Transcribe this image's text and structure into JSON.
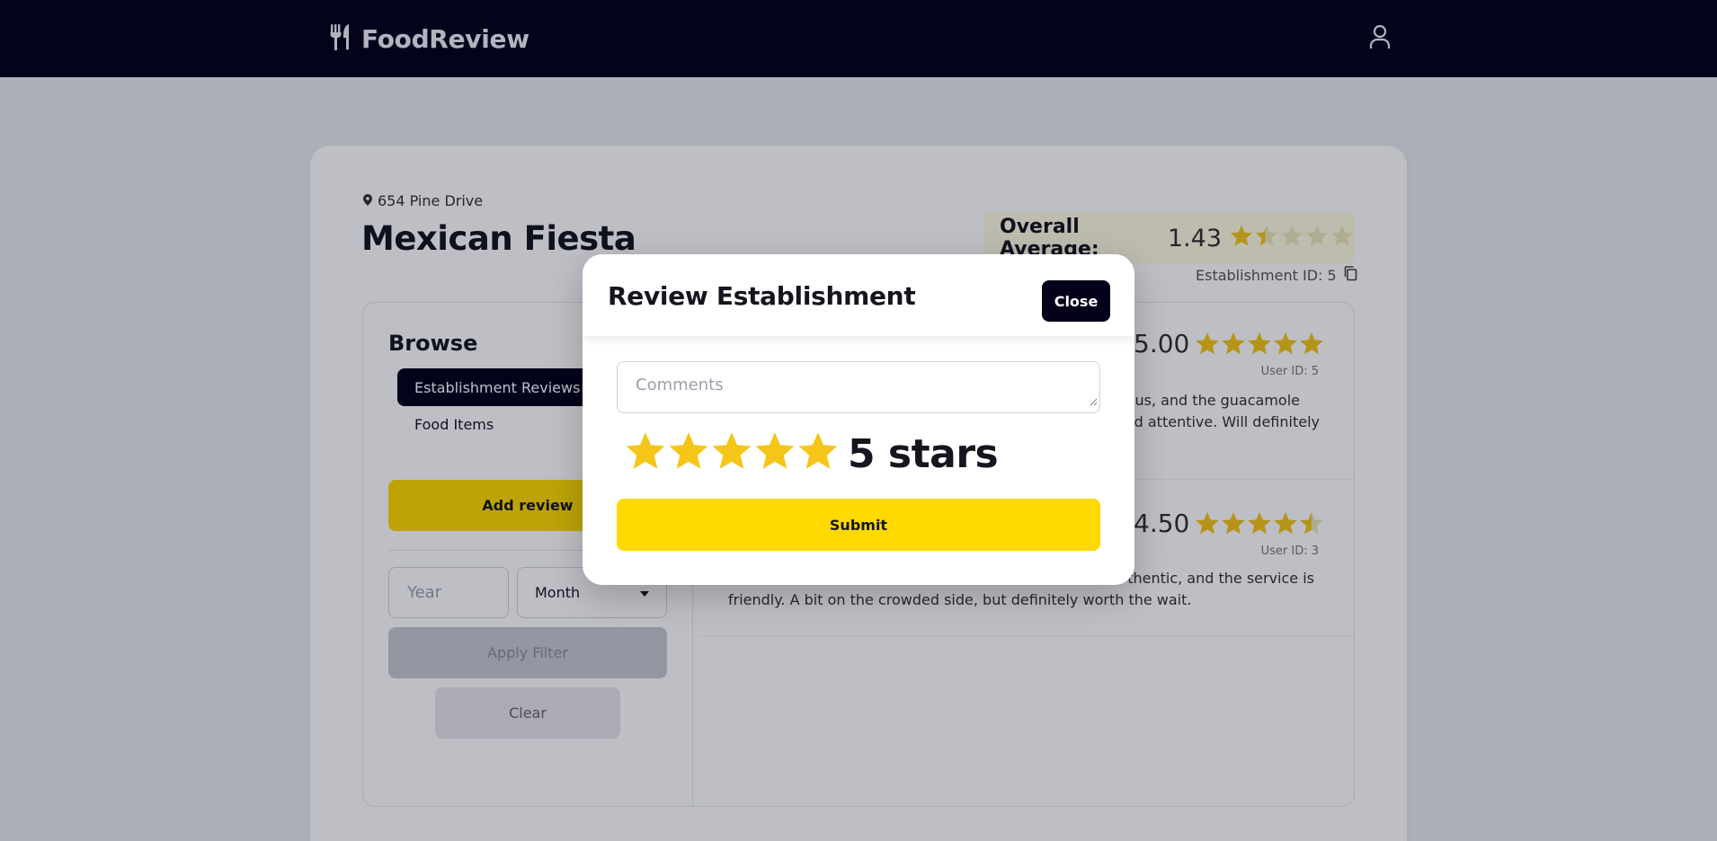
{
  "app": {
    "brand": "FoodReview"
  },
  "header": {
    "brand_icon": "fork-knife-icon",
    "user_icon": "user-icon"
  },
  "establishment": {
    "address": "654 Pine Drive",
    "name": "Mexican Fiesta",
    "overall_label": "Overall Average:",
    "overall_value": "1.43",
    "overall_rating": 1.43,
    "id_text": "Establishment ID: 5"
  },
  "sidebar": {
    "title": "Browse",
    "tabs": [
      {
        "label": "Establishment Reviews",
        "active": true
      },
      {
        "label": "Food Items",
        "active": false
      }
    ],
    "add_review": "Add review",
    "year_placeholder": "Year",
    "month_value": "Month",
    "apply_filter": "Apply Filter",
    "clear": "Clear"
  },
  "reviews": [
    {
      "score": "5.00",
      "rating": 5,
      "user": "User ID: 5",
      "text_line1": "cious, and the guacamole",
      "text_line2": "nd attentive. Will definitely"
    },
    {
      "score": "4.50",
      "rating": 4.5,
      "user": "User ID: 3",
      "text_line1": "thentic, and the service is",
      "text_line2": "friendly. A bit on the crowded side, but definitely worth the wait."
    }
  ],
  "modal": {
    "title": "Review Establishment",
    "close": "Close",
    "comments_placeholder": "Comments",
    "rating": 5,
    "rating_label": "5 stars",
    "submit": "Submit"
  },
  "colors": {
    "navy": "#03021a",
    "accent": "#ffd900",
    "star": "#f5c518",
    "star_empty": "#ede6b8"
  }
}
